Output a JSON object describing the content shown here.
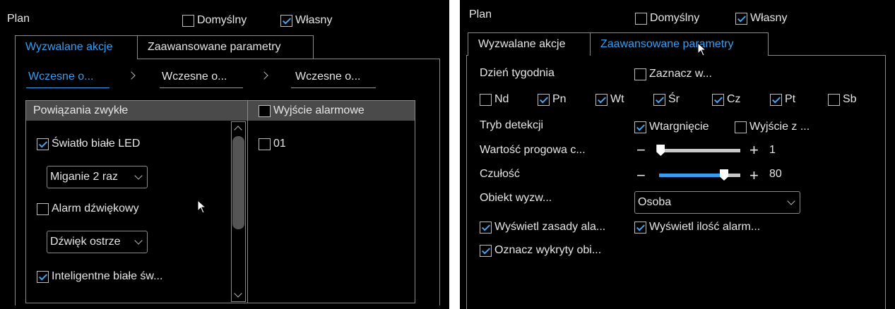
{
  "left": {
    "plan_label": "Plan",
    "mode_default": {
      "label": "Domyślny",
      "checked": false
    },
    "mode_custom": {
      "label": "Własny",
      "checked": true
    },
    "tabs": [
      "Wyzwalane akcje",
      "Zaawansowane parametry"
    ],
    "active_tab": 0,
    "breadcrumbs": [
      "Wczesne o...",
      "Wczesne o...",
      "Wczesne o..."
    ],
    "linkage_header": "Powiązania zwykłe",
    "alarm_out_header": {
      "label": "Wyjście alarmowe",
      "checked": false
    },
    "items": [
      {
        "label": "Światło białe LED",
        "checked": true
      },
      {
        "label": "Alarm dźwiękowy",
        "checked": false
      },
      {
        "label": "Inteligentne białe św...",
        "checked": true
      }
    ],
    "dropdown_flash": "Miganie 2 raz",
    "dropdown_sound": "Dźwięk ostrze",
    "alarm_outputs": [
      {
        "label": "01",
        "checked": false
      }
    ]
  },
  "right": {
    "plan_label": "Plan",
    "mode_default": {
      "label": "Domyślny",
      "checked": false
    },
    "mode_custom": {
      "label": "Własny",
      "checked": true
    },
    "tabs": [
      "Wyzwalane akcje",
      "Zaawansowane parametry"
    ],
    "active_tab": 1,
    "weekday_label": "Dzień tygodnia",
    "select_all": {
      "label": "Zaznacz w...",
      "checked": false
    },
    "days": [
      {
        "label": "Nd",
        "checked": false
      },
      {
        "label": "Pn",
        "checked": true
      },
      {
        "label": "Wt",
        "checked": true
      },
      {
        "label": "Śr",
        "checked": true
      },
      {
        "label": "Cz",
        "checked": true
      },
      {
        "label": "Pt",
        "checked": true
      },
      {
        "label": "Sb",
        "checked": false
      }
    ],
    "detection_mode_label": "Tryb detekcji",
    "intrusion": {
      "label": "Wtargnięcie",
      "checked": true
    },
    "exit": {
      "label": "Wyjście z ...",
      "checked": false
    },
    "threshold_label": "Wartość progowa c...",
    "threshold_value": "1",
    "threshold_fraction": 0.02,
    "sensitivity_label": "Czułość",
    "sensitivity_value": "80",
    "sensitivity_fraction": 0.8,
    "trigger_object_label": "Obiekt wyzw...",
    "trigger_object_value": "Osoba",
    "show_rules": {
      "label": "Wyświetl zasady ala...",
      "checked": true
    },
    "show_count": {
      "label": "Wyświetl ilość alarm...",
      "checked": true
    },
    "mark_object": {
      "label": "Oznacz wykryty obi...",
      "checked": true
    }
  },
  "colors": {
    "accent": "#3a9ef0",
    "check": "#4aa3f0",
    "header_bg": "#4a4a4a"
  }
}
